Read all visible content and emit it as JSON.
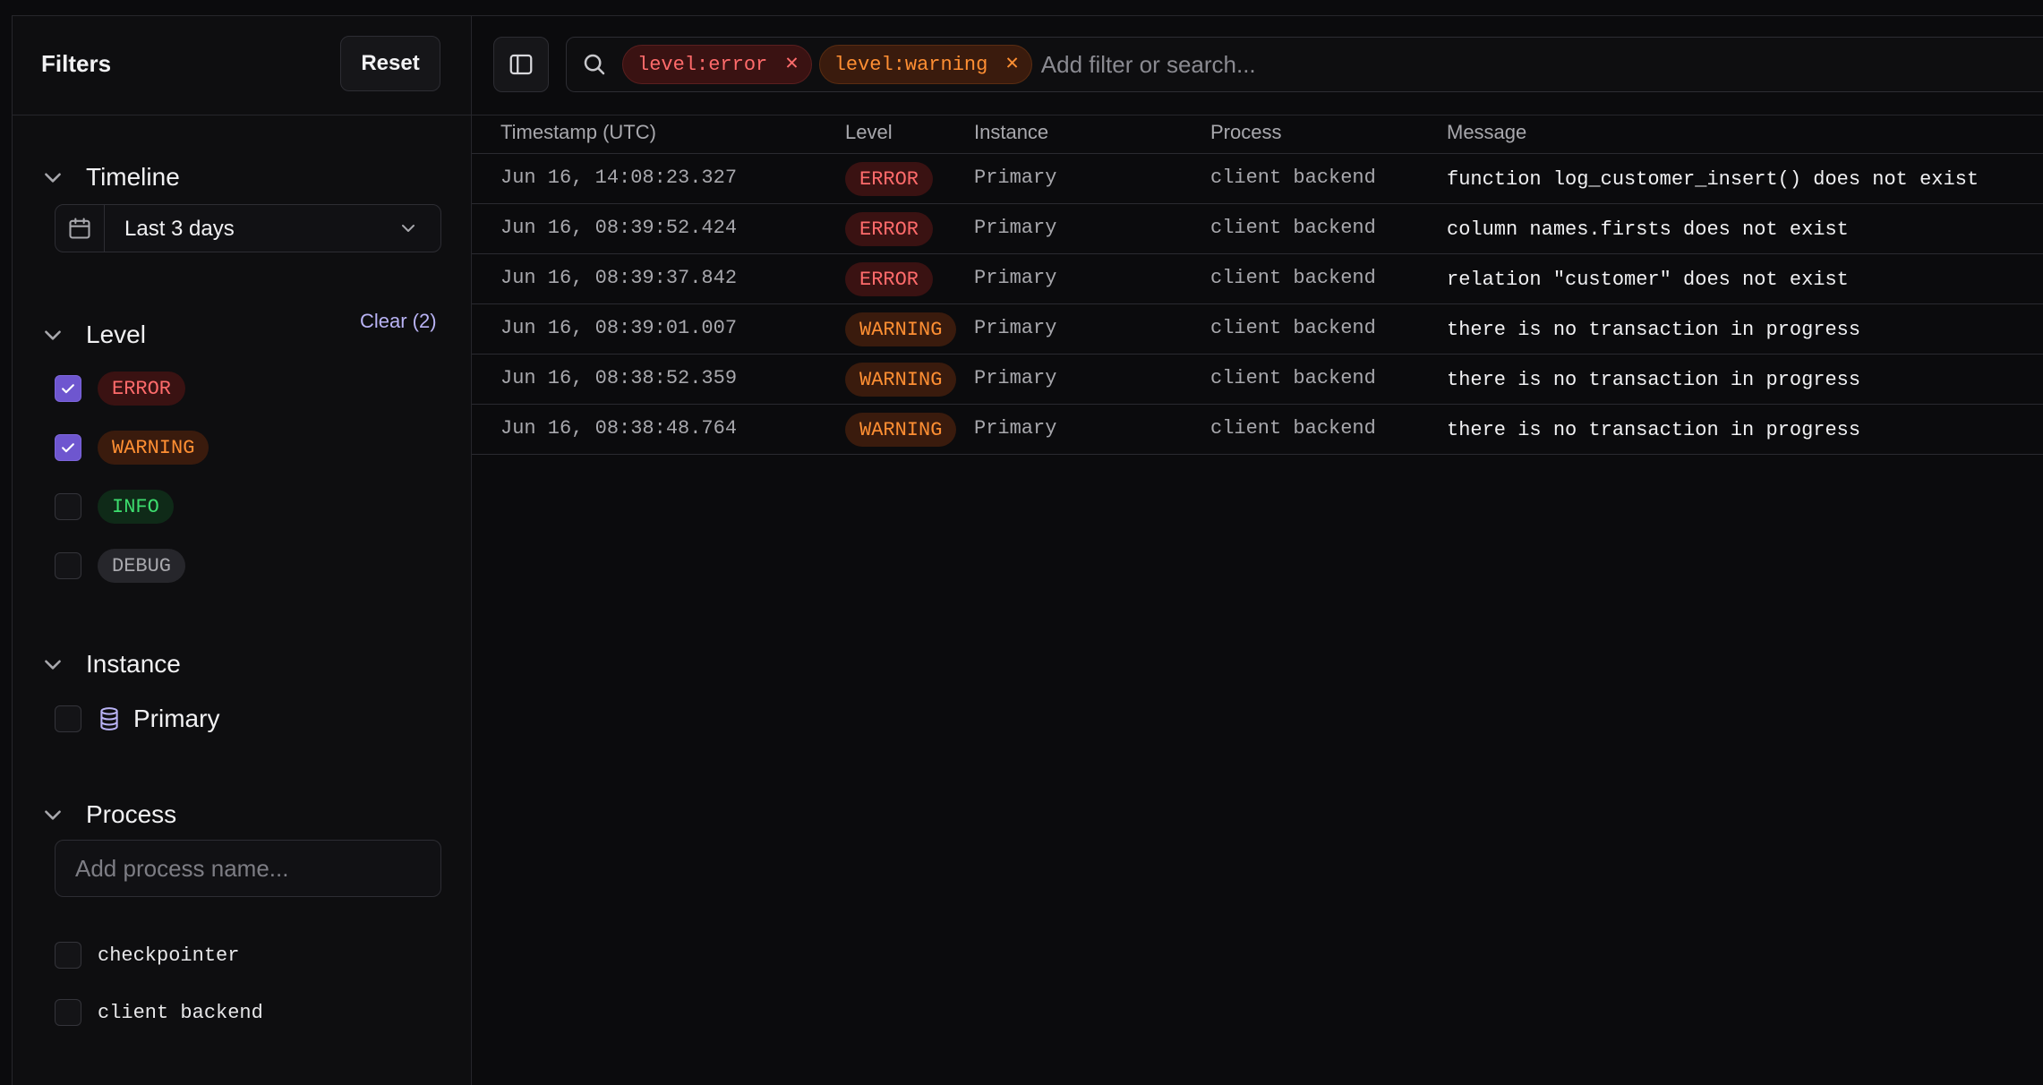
{
  "sidebar": {
    "title": "Filters",
    "reset_label": "Reset",
    "timeline": {
      "title": "Timeline",
      "selected": "Last 3 days"
    },
    "level": {
      "title": "Level",
      "clear_label": "Clear (2)",
      "options": [
        {
          "label": "ERROR",
          "checked": true
        },
        {
          "label": "WARNING",
          "checked": true
        },
        {
          "label": "INFO",
          "checked": false
        },
        {
          "label": "DEBUG",
          "checked": false
        }
      ]
    },
    "instance": {
      "title": "Instance",
      "options": [
        {
          "label": "Primary",
          "checked": false,
          "icon": "database-icon"
        }
      ]
    },
    "process": {
      "title": "Process",
      "placeholder": "Add process name...",
      "options": [
        {
          "label": "checkpointer",
          "checked": false
        },
        {
          "label": "client backend",
          "checked": false
        }
      ]
    }
  },
  "toolbar": {
    "search_placeholder": "Add filter or search...",
    "chips": [
      {
        "label": "level:error",
        "kind": "error"
      },
      {
        "label": "level:warning",
        "kind": "warning"
      }
    ]
  },
  "table": {
    "columns": [
      "Timestamp (UTC)",
      "Level",
      "Instance",
      "Process",
      "Message"
    ],
    "rows": [
      {
        "timestamp": "Jun 16, 14:08:23.327",
        "level": "ERROR",
        "instance": "Primary",
        "process": "client backend",
        "message": "function log_customer_insert() does not exist"
      },
      {
        "timestamp": "Jun 16, 08:39:52.424",
        "level": "ERROR",
        "instance": "Primary",
        "process": "client backend",
        "message": "column names.firsts does not exist"
      },
      {
        "timestamp": "Jun 16, 08:39:37.842",
        "level": "ERROR",
        "instance": "Primary",
        "process": "client backend",
        "message": "relation \"customer\" does not exist"
      },
      {
        "timestamp": "Jun 16, 08:39:01.007",
        "level": "WARNING",
        "instance": "Primary",
        "process": "client backend",
        "message": "there is no transaction in progress"
      },
      {
        "timestamp": "Jun 16, 08:38:52.359",
        "level": "WARNING",
        "instance": "Primary",
        "process": "client backend",
        "message": "there is no transaction in progress"
      },
      {
        "timestamp": "Jun 16, 08:38:48.764",
        "level": "WARNING",
        "instance": "Primary",
        "process": "client backend",
        "message": "there is no transaction in progress"
      }
    ]
  },
  "colors": {
    "accent": "#6e56cf",
    "error": "#ff6b6b",
    "warning": "#ff8f33",
    "info": "#3ddc6e"
  }
}
